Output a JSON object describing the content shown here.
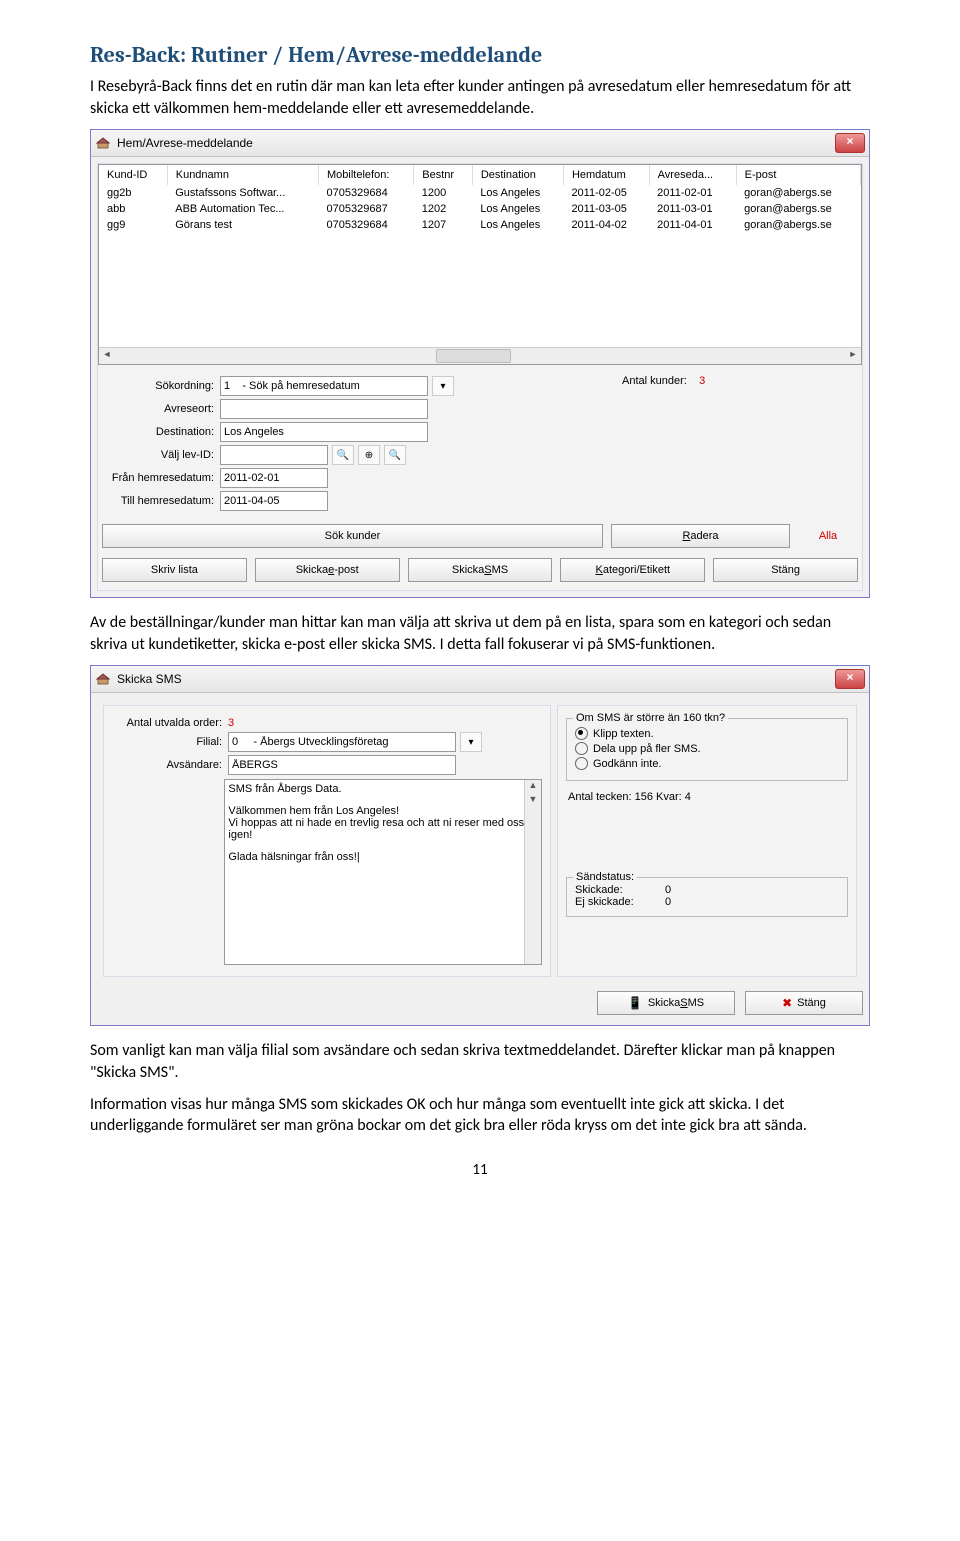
{
  "doc": {
    "heading": "Res-Back: Rutiner / Hem/Avrese-meddelande",
    "intro": "I Resebyrå-Back finns det en rutin där man kan leta efter kunder antingen på avresedatum eller hemresedatum för att skicka ett välkommen hem-meddelande eller ett avresemeddelande.",
    "mid": "Av de beställningar/kunder man hittar kan man välja att skriva ut dem på en lista, spara som en kategori och sedan skriva ut kundetiketter, skicka e-post eller skicka SMS. I detta fall fokuserar vi på SMS-funktionen.",
    "p3": "Som vanligt kan man välja filial som avsändare och sedan skriva textmeddelandet. Därefter klickar man på knappen \"Skicka SMS\".",
    "p4": "Information visas hur många SMS som skickades OK och hur många som eventuellt inte gick att skicka. I det underliggande formuläret ser man gröna bockar om det gick bra eller röda kryss om det inte gick bra att sända.",
    "pagenum": "11"
  },
  "win1": {
    "title": "Hem/Avrese-meddelande",
    "cols": {
      "c1": "Kund-ID",
      "c2": "Kundnamn",
      "c3": "Mobiltelefon:",
      "c4": "Bestnr",
      "c5": "Destination",
      "c6": "Hemdatum",
      "c7": "Avreseda...",
      "c8": "E-post"
    },
    "rows": [
      {
        "c1": "gg2b",
        "c2": "Gustafssons Softwar...",
        "c3": "0705329684",
        "c4": "1200",
        "c5": "Los Angeles",
        "c6": "2011-02-05",
        "c7": "2011-02-01",
        "c8": "goran@abergs.se"
      },
      {
        "c1": "abb",
        "c2": "ABB Automation Tec...",
        "c3": "0705329687",
        "c4": "1202",
        "c5": "Los Angeles",
        "c6": "2011-03-05",
        "c7": "2011-03-01",
        "c8": "goran@abergs.se"
      },
      {
        "c1": "gg9",
        "c2": "Görans test",
        "c3": "0705329684",
        "c4": "1207",
        "c5": "Los Angeles",
        "c6": "2011-04-02",
        "c7": "2011-04-01",
        "c8": "goran@abergs.se"
      }
    ],
    "form": {
      "sokordning_lbl": "Sökordning:",
      "sokordning_val": "1    - Sök på hemresedatum",
      "avreseort_lbl": "Avreseort:",
      "avreseort_val": "",
      "destination_lbl": "Destination:",
      "destination_val": "Los Angeles",
      "levid_lbl": "Välj lev-ID:",
      "levid_val": "",
      "fran_lbl": "Från hemresedatum:",
      "fran_val": "2011-02-01",
      "till_lbl": "Till hemresedatum:",
      "till_val": "2011-04-05",
      "antal_lbl": "Antal kunder:",
      "antal_val": "3",
      "btn_sok": "Sök kunder",
      "btn_radera": "Radera",
      "btn_alla": "Alla",
      "btn_skrivlista": "Skriv lista",
      "btn_epost": "Skicka e-post",
      "btn_sms": "Skicka SMS",
      "btn_kat": "Kategori/Etikett",
      "btn_stang": "Stäng"
    }
  },
  "win2": {
    "title": "Skicka SMS",
    "antal_lbl": "Antal utvalda order:",
    "antal_val": "3",
    "filial_lbl": "Filial:",
    "filial_val": "0     - Åbergs Utvecklingsföretag",
    "avs_lbl": "Avsändare:",
    "avs_val": "ÅBERGS",
    "sms_l1": "SMS från Åbergs Data.",
    "sms_l2": "Välkommen hem från Los Angeles!",
    "sms_l3": "Vi hoppas att ni hade en trevlig resa och att ni reser med oss igen!",
    "sms_l4": "Glada hälsningar från oss!|",
    "group1_legend": "Om SMS är större än 160 tkn?",
    "r1": "Klipp texten.",
    "r2": "Dela upp på fler SMS.",
    "r3": "Godkänn inte.",
    "tecken": "Antal tecken: 156 Kvar: 4",
    "group2_legend": "Sändstatus:",
    "skickade_lbl": "Skickade:",
    "skickade_val": "0",
    "ej_lbl": "Ej skickade:",
    "ej_val": "0",
    "btn_skicka": "Skicka SMS",
    "btn_stang": "Stäng"
  }
}
